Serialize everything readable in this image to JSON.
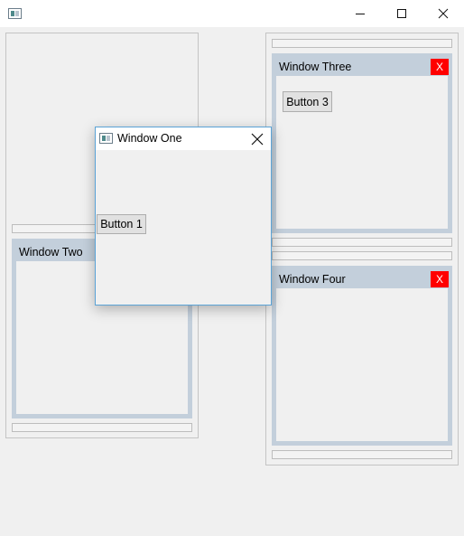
{
  "main_window": {
    "title": "",
    "controls": [
      "minimize-icon",
      "maximize-icon",
      "close-icon"
    ]
  },
  "left_panel": {
    "window_two": {
      "title": "Window Two"
    }
  },
  "right_panel": {
    "window_three": {
      "title": "Window Three",
      "close_label": "X",
      "button_label": "Button 3"
    },
    "window_four": {
      "title": "Window Four",
      "close_label": "X"
    }
  },
  "dialog": {
    "title": "Window One",
    "button_label": "Button 1"
  },
  "colors": {
    "mdi_frame": "#c3cfdb",
    "close_red": "#ff0000",
    "dialog_border": "#5ba3d6"
  }
}
